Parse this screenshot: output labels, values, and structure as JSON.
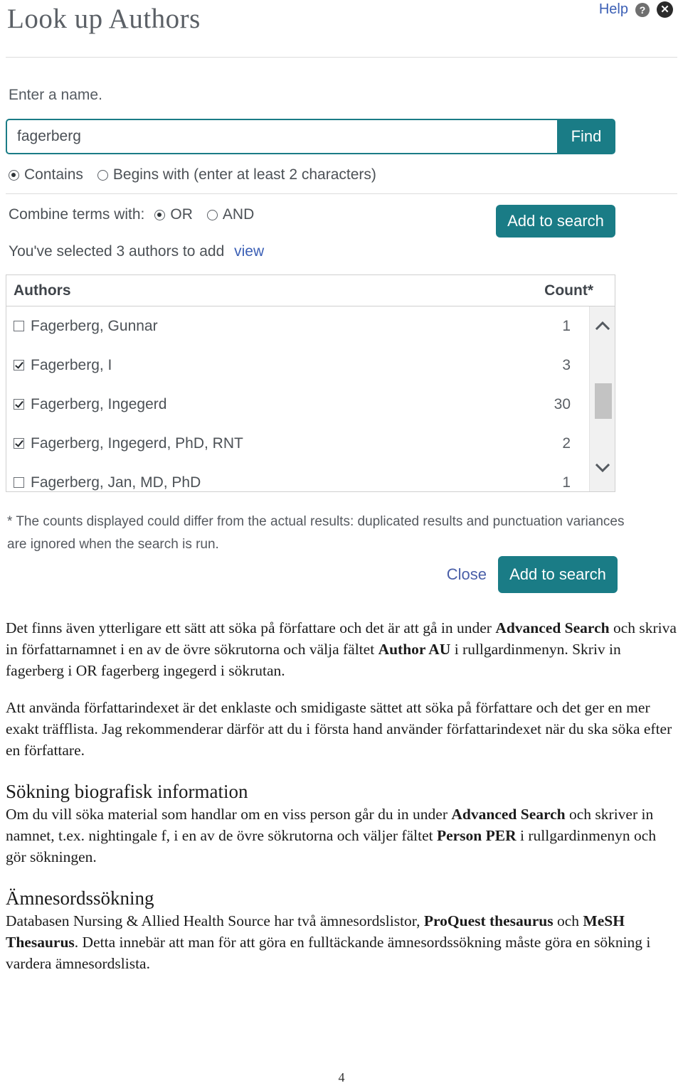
{
  "widget": {
    "title": "Look up Authors",
    "help_label": "Help",
    "help_icon": "question-mark-icon",
    "close_icon": "close-icon",
    "enter_name_label": "Enter a name.",
    "search": {
      "value": "fagerberg",
      "placeholder": "",
      "find_label": "Find"
    },
    "match_mode": {
      "options": [
        {
          "label": "Contains",
          "selected": true
        },
        {
          "label": "Begins with (enter at least 2 characters)",
          "selected": false
        }
      ]
    },
    "combine": {
      "label": "Combine terms with:",
      "options": [
        {
          "label": "OR",
          "selected": true
        },
        {
          "label": "AND",
          "selected": false
        }
      ]
    },
    "add_to_search_top_label": "Add to search",
    "selection_status": "You've selected 3 authors to add",
    "view_link_label": "view",
    "table": {
      "columns": [
        "Authors",
        "Count*"
      ],
      "rows": [
        {
          "name": "Fagerberg, Gunnar",
          "count": "1",
          "checked": false
        },
        {
          "name": "Fagerberg, I",
          "count": "3",
          "checked": true
        },
        {
          "name": "Fagerberg, Ingegerd",
          "count": "30",
          "checked": true
        },
        {
          "name": "Fagerberg, Ingegerd, PhD, RNT",
          "count": "2",
          "checked": true
        },
        {
          "name": "Fagerberg, Jan, MD, PhD",
          "count": "1",
          "checked": false
        }
      ]
    },
    "scrollbar": {
      "up_icon": "chevron-up-icon",
      "down_icon": "chevron-down-icon"
    },
    "footnote": "* The counts displayed could differ from the actual results: duplicated results and punctuation variances are ignored when the search is run.",
    "close_label": "Close",
    "add_to_search_bottom_label": "Add to search"
  },
  "document": {
    "paragraph_1_part_1": "Det finns även ytterligare ett sätt att söka på författare och det är att gå in under ",
    "paragraph_1_bold_1": "Advanced Search",
    "paragraph_1_part_2": " och skriva in författarnamnet i en av de övre sökrutorna och välja fältet ",
    "paragraph_1_bold_2": "Author AU",
    "paragraph_1_part_3": " i rullgardinmenyn. Skriv in fagerberg i OR fagerberg ingegerd i sökrutan.",
    "paragraph_2": "Att använda författarindexet är det enklaste och smidigaste sättet att söka på författare och det ger en mer exakt träfflista. Jag rekommenderar därför att du i första hand använder författarindexet när du ska söka efter en författare.",
    "heading_1": "Sökning biografisk information",
    "paragraph_3_part_1": "Om du vill söka material som handlar om en viss person går du in under ",
    "paragraph_3_bold_1": "Advanced Search",
    "paragraph_3_part_2": " och skriver in namnet, t.ex. nightingale f, i en av de övre sökrutorna och väljer fältet ",
    "paragraph_3_bold_2": "Person PER",
    "paragraph_3_part_3": " i rullgardinmenyn och gör sökningen.",
    "heading_2": "Ämnesordssökning",
    "paragraph_4_part_1": "Databasen Nursing & Allied Health Source har två ämnesordslistor, ",
    "paragraph_4_bold_1": "ProQuest thesaurus",
    "paragraph_4_part_2": " och ",
    "paragraph_4_bold_2": "MeSH Thesaurus",
    "paragraph_4_part_3": ". Detta innebär att man för att göra en fulltäckande ämnesordssökning måste göra en sökning i vardera ämnesordslista.",
    "page_number": "4"
  },
  "colors": {
    "teal_accent": "#1a7c86",
    "link_blue": "#3b5fb5",
    "title_gray": "#5b6066"
  }
}
